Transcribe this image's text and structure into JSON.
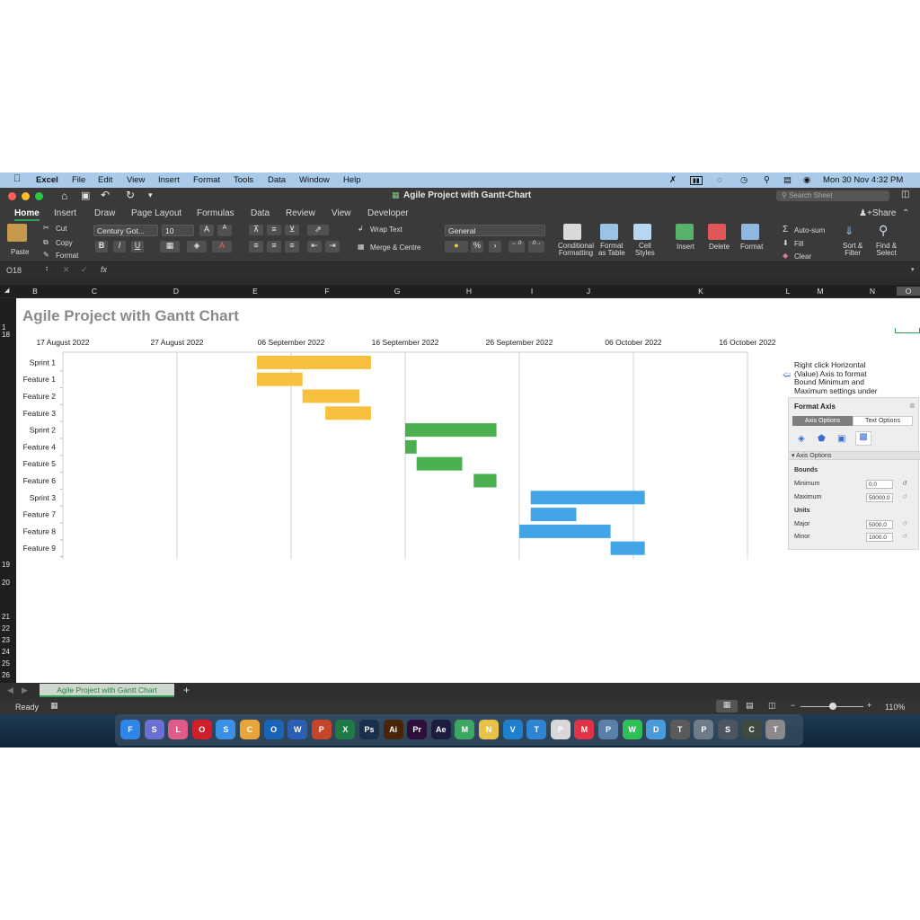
{
  "menubar": {
    "app": "Excel",
    "items": [
      "File",
      "Edit",
      "View",
      "Insert",
      "Format",
      "Tools",
      "Data",
      "Window",
      "Help"
    ],
    "clock": "Mon 30 Nov  4:32 PM"
  },
  "window": {
    "title": "Agile Project with Gantt-Chart",
    "search_placeholder": "Search Sheet",
    "share_label": "Share"
  },
  "ribbon_tabs": [
    "Home",
    "Insert",
    "Draw",
    "Page Layout",
    "Formulas",
    "Data",
    "Review",
    "View",
    "Developer"
  ],
  "ribbon": {
    "paste": "Paste",
    "cut": "Cut",
    "copy": "Copy",
    "format_painter": "Format",
    "font_name": "Century Got...",
    "font_size": "10",
    "grow_font": "A",
    "shrink_font": "A",
    "bold": "B",
    "italic": "I",
    "underline": "U",
    "wrap_text": "Wrap Text",
    "merge_centre": "Merge & Centre",
    "number_format": "General",
    "percent": "%",
    "comma": "›",
    "conditional_formatting": [
      "Conditional",
      "Formatting"
    ],
    "format_as_table": [
      "Format",
      "as Table"
    ],
    "cell_styles": [
      "Cell",
      "Styles"
    ],
    "insert": "Insert",
    "delete": "Delete",
    "format": "Format",
    "auto_sum": "Auto-sum",
    "fill": "Fill",
    "clear": "Clear",
    "sort_filter": [
      "Sort &",
      "Filter"
    ],
    "find_select": [
      "Find &",
      "Select"
    ]
  },
  "formula_bar": {
    "name_box": "O18",
    "fx": "fx",
    "value": ""
  },
  "columns": [
    "B",
    "C",
    "D",
    "E",
    "F",
    "G",
    "H",
    "I",
    "J",
    "K",
    "L",
    "M",
    "N",
    "O"
  ],
  "rows": [
    "1",
    "18",
    "19",
    "20",
    "21",
    "22",
    "23",
    "24",
    "25",
    "26"
  ],
  "sheet_title": "Agile Project with Gantt Chart",
  "chart_data": {
    "type": "bar",
    "orientation": "horizontal-gantt",
    "xaxis_ticks": [
      "17 August 2022",
      "27 August 2022",
      "06 September 2022",
      "16 September 2022",
      "26 September 2022",
      "06 October 2022",
      "16 October 2022"
    ],
    "xlim": [
      "2022-08-17",
      "2022-10-16"
    ],
    "categories": [
      "Sprint 1",
      "Feature 1",
      "Feature 2",
      "Feature 3",
      "Sprint 2",
      "Feature 4",
      "Feature 5",
      "Feature 6",
      "Sprint 3",
      "Feature 7",
      "Feature 8",
      "Feature 9"
    ],
    "start": [
      "2022-09-03",
      "2022-09-03",
      "2022-09-07",
      "2022-09-09",
      "2022-09-16",
      "2022-09-16",
      "2022-09-17",
      "2022-09-22",
      "2022-09-27",
      "2022-09-27",
      "2022-09-26",
      "2022-10-04"
    ],
    "end": [
      "2022-09-13",
      "2022-09-07",
      "2022-09-12",
      "2022-09-13",
      "2022-09-24",
      "2022-09-17",
      "2022-09-21",
      "2022-09-24",
      "2022-10-07",
      "2022-10-01",
      "2022-10-04",
      "2022-10-07"
    ],
    "colors": [
      "#f7c03f",
      "#f7c03f",
      "#f7c03f",
      "#f7c03f",
      "#4caf50",
      "#4caf50",
      "#4caf50",
      "#4caf50",
      "#42a5e8",
      "#42a5e8",
      "#42a5e8",
      "#42a5e8"
    ],
    "grid": true
  },
  "note": {
    "lines": [
      "Right click Horizontal",
      "(Value) Axis to format",
      "Bound Minimum and",
      "Maximum settings under"
    ]
  },
  "format_axis": {
    "title": "Format Axis",
    "tab_axis": "Axis Options",
    "tab_text": "Text Options",
    "section": "Axis Options",
    "bounds": "Bounds",
    "minimum_label": "Minimum",
    "minimum_value": "0.0",
    "maximum_label": "Maximum",
    "maximum_value": "50000.0",
    "units": "Units",
    "major_label": "Major",
    "major_value": "5000.0",
    "minor_label": "Minor",
    "minor_value": "1000.0"
  },
  "sheet_tab": "Agile Project with Gantt Chart",
  "status": {
    "ready": "Ready",
    "zoom": "110%"
  },
  "dock_apps": [
    {
      "label": "F",
      "color": "#2f86e8"
    },
    {
      "label": "S",
      "color": "#6a6fd1"
    },
    {
      "label": "L",
      "color": "#e05a8a"
    },
    {
      "label": "O",
      "color": "#cf1f2a"
    },
    {
      "label": "S",
      "color": "#3b8fe6"
    },
    {
      "label": "C",
      "color": "#e9a43a"
    },
    {
      "label": "O",
      "color": "#1a64b8"
    },
    {
      "label": "W",
      "color": "#2b5fb4"
    },
    {
      "label": "P",
      "color": "#c6452a"
    },
    {
      "label": "X",
      "color": "#1f7a45"
    },
    {
      "label": "Ps",
      "color": "#1a2f4d"
    },
    {
      "label": "Ai",
      "color": "#4a2408"
    },
    {
      "label": "Pr",
      "color": "#2c0f3a"
    },
    {
      "label": "Ae",
      "color": "#1c1c3f"
    },
    {
      "label": "M",
      "color": "#3aa860"
    },
    {
      "label": "N",
      "color": "#e6c24a"
    },
    {
      "label": "V",
      "color": "#1f7fcf"
    },
    {
      "label": "T",
      "color": "#2f84d4"
    },
    {
      "label": "P",
      "color": "#d8d8d8"
    },
    {
      "label": "M",
      "color": "#e0334a"
    },
    {
      "label": "P",
      "color": "#5a7fa8"
    },
    {
      "label": "W",
      "color": "#2fbf57"
    },
    {
      "label": "D",
      "color": "#4a9ad8"
    },
    {
      "label": "T",
      "color": "#5a5a5a"
    },
    {
      "label": "P",
      "color": "#6e7c8a"
    },
    {
      "label": "S",
      "color": "#4a5560"
    },
    {
      "label": "C",
      "color": "#3d4a3f"
    },
    {
      "label": "T",
      "color": "#8a8a8a"
    }
  ]
}
